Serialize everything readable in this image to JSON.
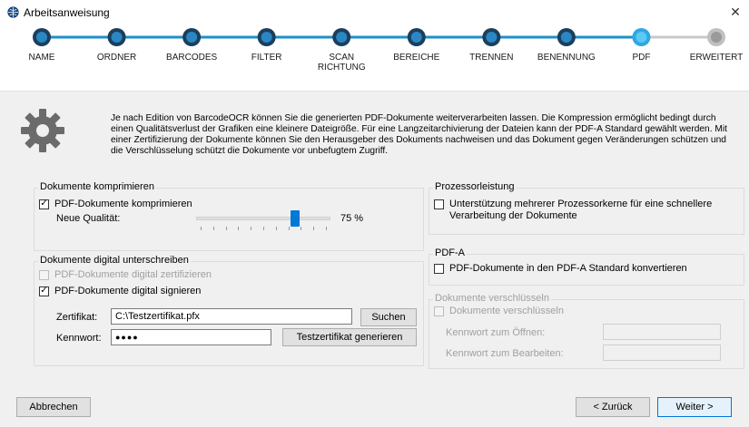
{
  "window": {
    "title": "Arbeitsanweisung",
    "close": "✕"
  },
  "wizard": {
    "accent": "#1e90c8",
    "steps": [
      {
        "label": "NAME",
        "state": "done"
      },
      {
        "label": "ORDNER",
        "state": "done"
      },
      {
        "label": "BARCODES",
        "state": "done"
      },
      {
        "label": "FILTER",
        "state": "done"
      },
      {
        "label": "SCAN\nRICHTUNG",
        "state": "done"
      },
      {
        "label": "BEREICHE",
        "state": "done"
      },
      {
        "label": "TRENNEN",
        "state": "done"
      },
      {
        "label": "BENENNUNG",
        "state": "done"
      },
      {
        "label": "PDF",
        "state": "current"
      },
      {
        "label": "ERWEITERT",
        "state": "todo"
      }
    ]
  },
  "intro": "Je nach Edition von BarcodeOCR können Sie die generierten PDF-Dokumente weiterverarbeiten lassen. Die Kompression ermöglicht bedingt durch einen Qualitätsverlust der Grafiken eine kleinere Dateigröße. Für eine Langzeitarchivierung der Dateien kann der PDF-A Standard gewählt werden. Mit einer Zertifizierung der Dokumente können Sie den Herausgeber des Dokuments nachweisen und das Dokument gegen Veränderungen schützen und die Verschlüsselung schützt die Dokumente vor unbefugtem Zugriff.",
  "compress": {
    "title": "Dokumente komprimieren",
    "checkbox_label": "PDF-Dokumente komprimieren",
    "checked": true,
    "quality_label": "Neue Qualität:",
    "quality_value": 75,
    "quality_text": "75 %"
  },
  "sign": {
    "title": "Dokumente digital unterschreiben",
    "certify_label": "PDF-Dokumente digital zertifizieren",
    "certify_checked": false,
    "sign_label": "PDF-Dokumente digital signieren",
    "sign_checked": true,
    "cert_label": "Zertifikat:",
    "cert_value": "C:\\Testzertifikat.pfx",
    "search_button": "Suchen",
    "password_label": "Kennwort:",
    "password_value": "●●●●",
    "generate_button": "Testzertifikat generieren"
  },
  "processor": {
    "title": "Prozessorleistung",
    "checkbox_label": "Unterstützung mehrerer Prozessorkerne für eine schnellere\nVerarbeitung der Dokumente",
    "checked": false
  },
  "pdfa": {
    "title": "PDF-A",
    "checkbox_label": "PDF-Dokumente in den PDF-A Standard konvertieren",
    "checked": false
  },
  "encrypt": {
    "title": "Dokumente verschlüsseln",
    "checkbox_label": "Dokumente verschlüsseln",
    "checked": false,
    "open_pw_label": "Kennwort zum Öffnen:",
    "edit_pw_label": "Kennwort zum Bearbeiten:"
  },
  "footer": {
    "cancel": "Abbrechen",
    "back": "< Zurück",
    "next": "Weiter >"
  }
}
